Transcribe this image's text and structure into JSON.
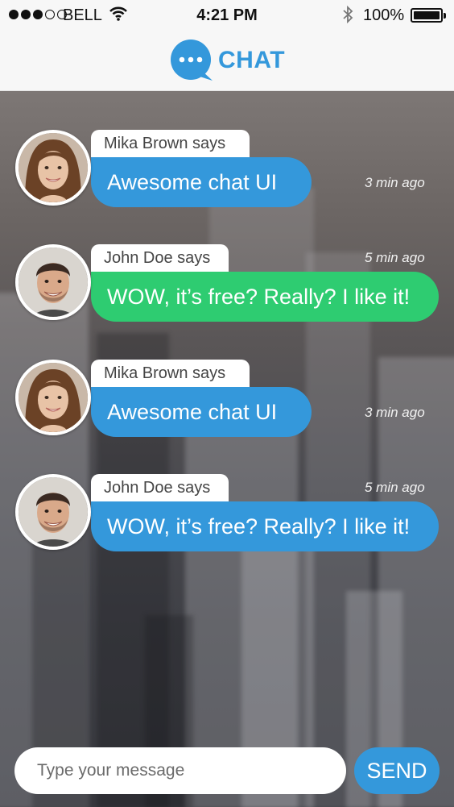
{
  "status_bar": {
    "carrier": "BELL",
    "time": "4:21 PM",
    "battery_percent": "100%",
    "signal_bars": 3,
    "signal_total": 5
  },
  "header": {
    "logo_text": "CHAT",
    "brand_color": "#3498db"
  },
  "messages": [
    {
      "sender": "Mika Brown says",
      "text": "Awesome chat UI",
      "time": "3 min ago",
      "color": "blue",
      "avatar": "female-avatar"
    },
    {
      "sender": "John Doe says",
      "text": "WOW, it’s free? Really? I like it!",
      "time": "5 min ago",
      "color": "green",
      "avatar": "male-avatar"
    },
    {
      "sender": "Mika Brown says",
      "text": "Awesome chat UI",
      "time": "3 min ago",
      "color": "blue",
      "avatar": "female-avatar"
    },
    {
      "sender": "John Doe says",
      "text": "WOW, it’s free? Really? I like it!",
      "time": "5 min ago",
      "color": "blue",
      "avatar": "male-avatar"
    }
  ],
  "composer": {
    "placeholder": "Type your message",
    "value": "",
    "send_label": "SEND"
  },
  "colors": {
    "blue_bubble": "#3498db",
    "green_bubble": "#2ecc71"
  }
}
